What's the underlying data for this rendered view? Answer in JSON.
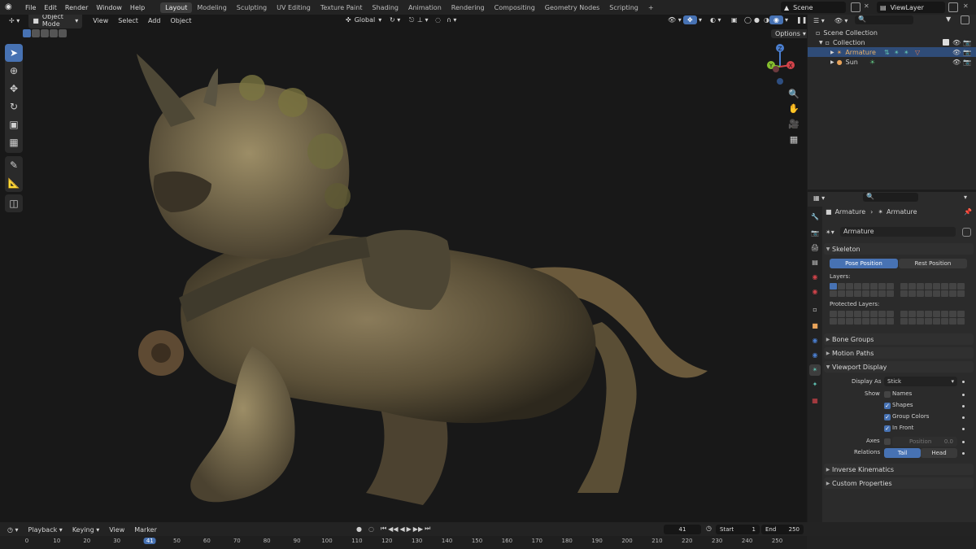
{
  "topbar": {
    "menus": [
      "File",
      "Edit",
      "Render",
      "Window",
      "Help"
    ],
    "workspaces": [
      "Layout",
      "Modeling",
      "Sculpting",
      "UV Editing",
      "Texture Paint",
      "Shading",
      "Animation",
      "Rendering",
      "Compositing",
      "Geometry Nodes",
      "Scripting"
    ],
    "active_workspace": "Layout",
    "add_tab": "+",
    "scene": "Scene",
    "view_layer": "ViewLayer"
  },
  "viewport": {
    "mode": "Object Mode",
    "menus": [
      "View",
      "Select",
      "Add",
      "Object"
    ],
    "orientation": "Global",
    "options": "Options",
    "gizmo": {
      "z": "Z",
      "y": "Y",
      "x": "X"
    }
  },
  "outliner": {
    "search_placeholder": "",
    "rows": {
      "scene_collection": "Scene Collection",
      "collection": "Collection",
      "armature": "Armature",
      "sun": "Sun"
    }
  },
  "properties": {
    "breadcrumb": {
      "object": "Armature",
      "data": "Armature"
    },
    "data_name": "Armature",
    "skeleton": {
      "title": "Skeleton",
      "pose_position": "Pose Position",
      "rest_position": "Rest Position",
      "layers_label": "Layers:",
      "protected_label": "Protected Layers:"
    },
    "bone_groups": "Bone Groups",
    "motion_paths": "Motion Paths",
    "viewport_display": {
      "title": "Viewport Display",
      "display_as_label": "Display As",
      "display_as_value": "Stick",
      "show_label": "Show",
      "names": "Names",
      "shapes": "Shapes",
      "group_colors": "Group Colors",
      "in_front": "In Front",
      "axes_label": "Axes",
      "position_label": "Position",
      "position_value": "0.0",
      "relations_label": "Relations",
      "tail": "Tail",
      "head": "Head"
    },
    "inverse_kinematics": "Inverse Kinematics",
    "custom_properties": "Custom Properties"
  },
  "timeline": {
    "menus": [
      "Playback",
      "Keying",
      "View",
      "Marker"
    ],
    "current_frame": "41",
    "start_label": "Start",
    "start": "1",
    "end_label": "End",
    "end": "250",
    "ticks": [
      "0",
      "10",
      "20",
      "30",
      "41",
      "50",
      "60",
      "70",
      "80",
      "90",
      "100",
      "110",
      "120",
      "130",
      "140",
      "150",
      "160",
      "170",
      "180",
      "190",
      "200",
      "210",
      "220",
      "230",
      "240",
      "250"
    ]
  },
  "colors": {
    "accent": "#4772b3",
    "selected_row": "#2f4c78"
  }
}
